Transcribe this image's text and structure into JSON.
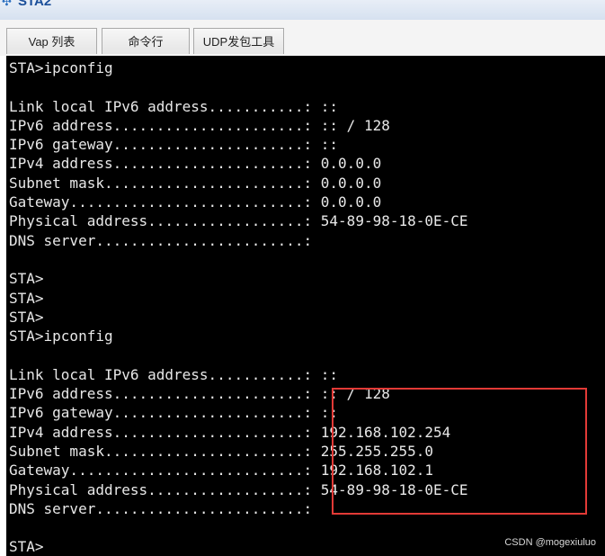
{
  "window": {
    "title": "STA2",
    "icon": "network-icon"
  },
  "tabs": [
    {
      "label": "Vap 列表"
    },
    {
      "label": "命令行"
    },
    {
      "label": "UDP发包工具"
    }
  ],
  "terminal": {
    "lines": [
      "STA>ipconfig",
      "",
      "Link local IPv6 address...........: ::",
      "IPv6 address......................: :: / 128",
      "IPv6 gateway......................: ::",
      "IPv4 address......................: 0.0.0.0",
      "Subnet mask.......................: 0.0.0.0",
      "Gateway...........................: 0.0.0.0",
      "Physical address..................: 54-89-98-18-0E-CE",
      "DNS server........................:",
      "",
      "STA>",
      "STA>",
      "STA>",
      "STA>ipconfig",
      "",
      "Link local IPv6 address...........: ::",
      "IPv6 address......................: :: / 128",
      "IPv6 gateway......................: ::",
      "IPv4 address......................: 192.168.102.254",
      "Subnet mask.......................: 255.255.255.0",
      "Gateway...........................: 192.168.102.1",
      "Physical address..................: 54-89-98-18-0E-CE",
      "DNS server........................:",
      "",
      "STA>"
    ],
    "background": "#000000",
    "foreground": "#e8e8e8"
  },
  "annotation": {
    "highlight_color": "#e23a36"
  },
  "watermark": "CSDN @mogexiuluo"
}
